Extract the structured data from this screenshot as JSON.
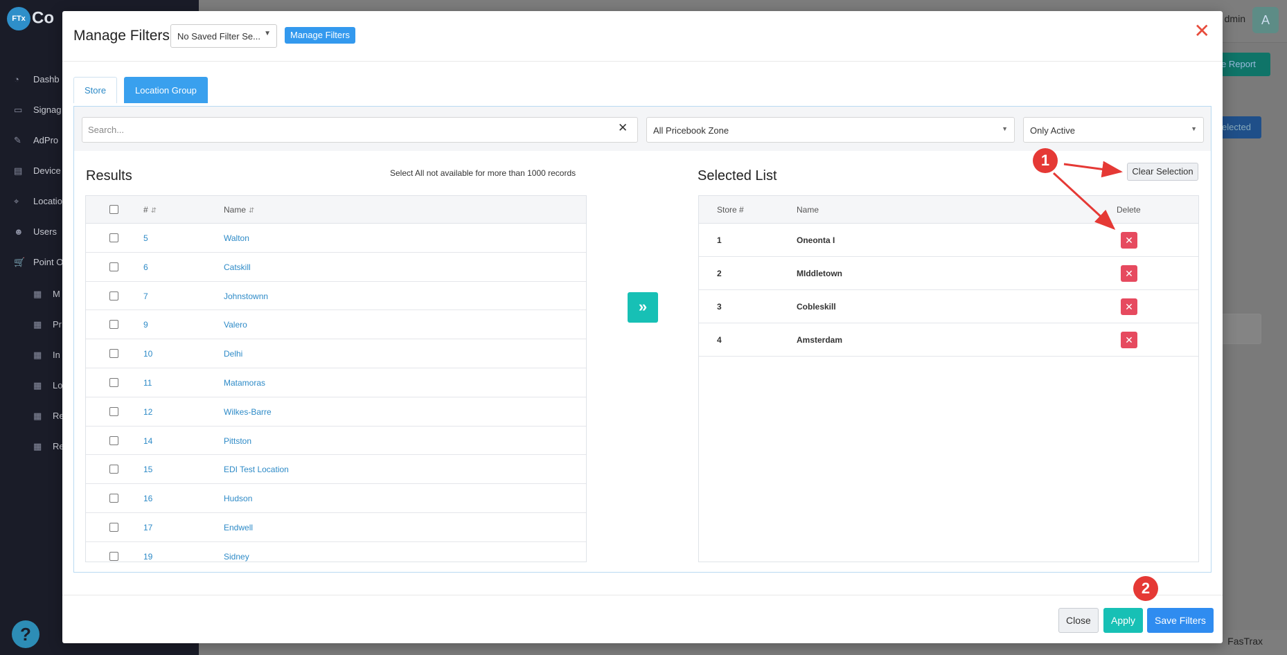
{
  "app": {
    "logo_text": "Co",
    "logo_badge": "FTx",
    "sidebar_items": [
      {
        "label": "Dashb",
        "icon": "dashboard-icon",
        "glyph": "◔"
      },
      {
        "label": "Signag",
        "icon": "monitor-icon",
        "glyph": "▭"
      },
      {
        "label": "AdPro",
        "icon": "pen-icon",
        "glyph": "✎"
      },
      {
        "label": "Device",
        "icon": "server-icon",
        "glyph": "▤"
      },
      {
        "label": "Locatio",
        "icon": "location-pin-icon",
        "glyph": "⌖"
      },
      {
        "label": "Users",
        "icon": "users-icon",
        "glyph": "☻"
      },
      {
        "label": "Point O",
        "icon": "cart-icon",
        "glyph": "🛒"
      }
    ],
    "sub_items": [
      "M",
      "Pr",
      "In",
      "Lo",
      "Re",
      "Re"
    ],
    "user_name": "dmin",
    "user_initial": "A",
    "report_button": "e Report",
    "selected_button": "elected",
    "footer_brand": "FasTrax",
    "help_label": "?"
  },
  "modal": {
    "title": "Manage Filters",
    "saved_filter_value": "No Saved Filter Se...",
    "manage_filters_label": "Manage Filters",
    "close_glyph": "✕",
    "tabs": [
      {
        "label": "Store",
        "active": false
      },
      {
        "label": "Location Group",
        "active": true
      }
    ],
    "search_placeholder": "Search...",
    "pricebook_zone": "All Pricebook Zone",
    "status_filter": "Only Active",
    "results": {
      "title": "Results",
      "note": "Select All not available for more than 1000 records",
      "columns": [
        "#",
        "Name"
      ],
      "rows": [
        {
          "num": "5",
          "name": "Walton"
        },
        {
          "num": "6",
          "name": "Catskill"
        },
        {
          "num": "7",
          "name": "Johnstownn"
        },
        {
          "num": "9",
          "name": "Valero"
        },
        {
          "num": "10",
          "name": "Delhi"
        },
        {
          "num": "11",
          "name": "Matamoras"
        },
        {
          "num": "12",
          "name": "Wilkes-Barre"
        },
        {
          "num": "14",
          "name": "Pittston"
        },
        {
          "num": "15",
          "name": "EDI Test Location"
        },
        {
          "num": "16",
          "name": "Hudson"
        },
        {
          "num": "17",
          "name": "Endwell"
        },
        {
          "num": "19",
          "name": "Sidney"
        }
      ]
    },
    "move_button_glyph": "»",
    "selected": {
      "title": "Selected List",
      "clear_label": "Clear Selection",
      "columns": [
        "Store #",
        "Name",
        "Delete"
      ],
      "rows": [
        {
          "num": "1",
          "name": "Oneonta I"
        },
        {
          "num": "2",
          "name": "MIddletown"
        },
        {
          "num": "3",
          "name": "Cobleskill"
        },
        {
          "num": "4",
          "name": "Amsterdam"
        }
      ]
    },
    "footer": {
      "close_label": "Close",
      "apply_label": "Apply",
      "save_label": "Save Filters"
    }
  },
  "annotations": {
    "badge_1": "1",
    "badge_2": "2",
    "color": "#e53935"
  }
}
